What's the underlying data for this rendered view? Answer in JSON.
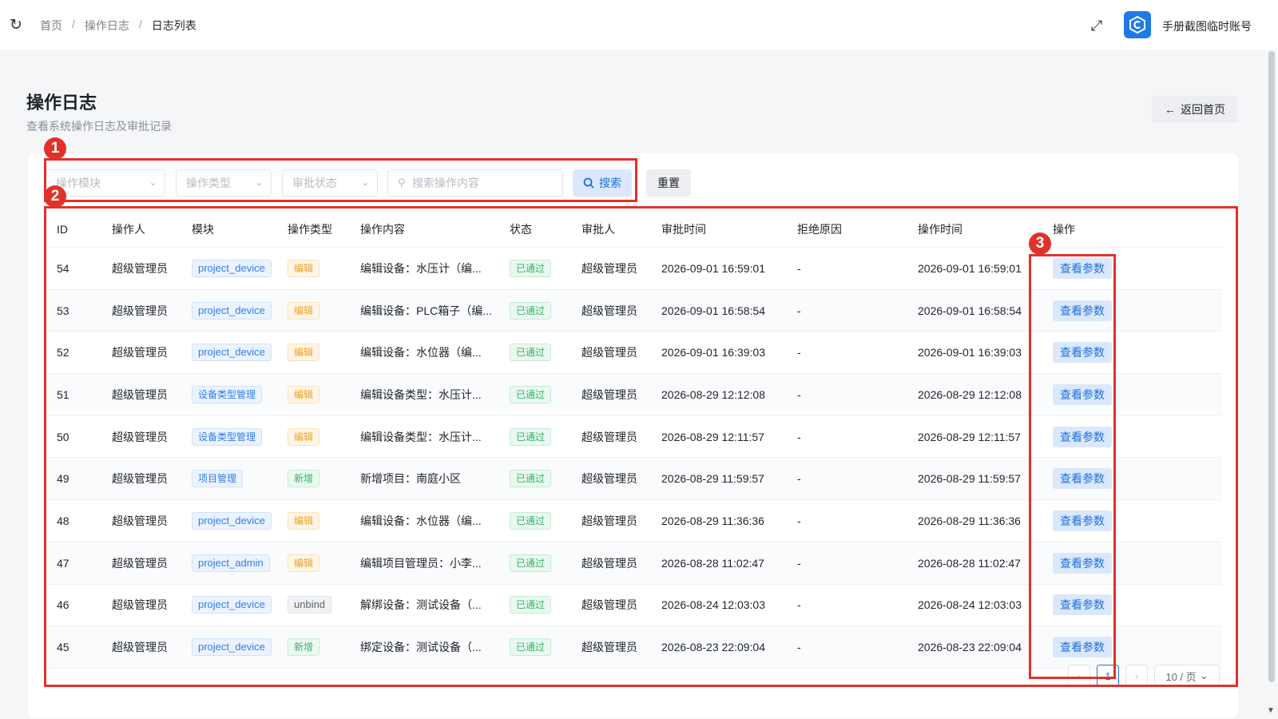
{
  "header": {
    "breadcrumb": [
      "首页",
      "操作日志",
      "日志列表"
    ],
    "breadcrumb_sep": "/",
    "username": "手册截图临时账号"
  },
  "page": {
    "title": "操作日志",
    "subtitle": "查看系统操作日志及审批记录",
    "back_label": "返回首页"
  },
  "filters": {
    "module_placeholder": "操作模块",
    "type_placeholder": "操作类型",
    "status_placeholder": "审批状态",
    "search_placeholder": "搜索操作内容",
    "search_label": "搜索",
    "reset_label": "重置"
  },
  "table": {
    "columns": [
      "ID",
      "操作人",
      "模块",
      "操作类型",
      "操作内容",
      "状态",
      "审批人",
      "审批时间",
      "拒绝原因",
      "操作时间",
      "操作"
    ],
    "rows": [
      {
        "id": "54",
        "operator": "超级管理员",
        "module": "project_device",
        "type": "编辑",
        "content": "编辑设备：水压计（编...",
        "status": "已通过",
        "approver": "超级管理员",
        "approve_time": "2026-09-01 16:59:01",
        "reason": "-",
        "op_time": "2026-09-01 16:59:01",
        "action": "查看参数"
      },
      {
        "id": "53",
        "operator": "超级管理员",
        "module": "project_device",
        "type": "编辑",
        "content": "编辑设备：PLC箱子（编...",
        "status": "已通过",
        "approver": "超级管理员",
        "approve_time": "2026-09-01 16:58:54",
        "reason": "-",
        "op_time": "2026-09-01 16:58:54",
        "action": "查看参数"
      },
      {
        "id": "52",
        "operator": "超级管理员",
        "module": "project_device",
        "type": "编辑",
        "content": "编辑设备：水位器（编...",
        "status": "已通过",
        "approver": "超级管理员",
        "approve_time": "2026-09-01 16:39:03",
        "reason": "-",
        "op_time": "2026-09-01 16:39:03",
        "action": "查看参数"
      },
      {
        "id": "51",
        "operator": "超级管理员",
        "module": "设备类型管理",
        "type": "编辑",
        "content": "编辑设备类型：水压计...",
        "status": "已通过",
        "approver": "超级管理员",
        "approve_time": "2026-08-29 12:12:08",
        "reason": "-",
        "op_time": "2026-08-29 12:12:08",
        "action": "查看参数"
      },
      {
        "id": "50",
        "operator": "超级管理员",
        "module": "设备类型管理",
        "type": "编辑",
        "content": "编辑设备类型：水压计...",
        "status": "已通过",
        "approver": "超级管理员",
        "approve_time": "2026-08-29 12:11:57",
        "reason": "-",
        "op_time": "2026-08-29 12:11:57",
        "action": "查看参数"
      },
      {
        "id": "49",
        "operator": "超级管理员",
        "module": "项目管理",
        "type": "新增",
        "content": "新增项目：南庭小区",
        "status": "已通过",
        "approver": "超级管理员",
        "approve_time": "2026-08-29 11:59:57",
        "reason": "-",
        "op_time": "2026-08-29 11:59:57",
        "action": "查看参数"
      },
      {
        "id": "48",
        "operator": "超级管理员",
        "module": "project_device",
        "type": "编辑",
        "content": "编辑设备：水位器（编...",
        "status": "已通过",
        "approver": "超级管理员",
        "approve_time": "2026-08-29 11:36:36",
        "reason": "-",
        "op_time": "2026-08-29 11:36:36",
        "action": "查看参数"
      },
      {
        "id": "47",
        "operator": "超级管理员",
        "module": "project_admin",
        "type": "编辑",
        "content": "编辑项目管理员：小李...",
        "status": "已通过",
        "approver": "超级管理员",
        "approve_time": "2026-08-28 11:02:47",
        "reason": "-",
        "op_time": "2026-08-28 11:02:47",
        "action": "查看参数"
      },
      {
        "id": "46",
        "operator": "超级管理员",
        "module": "project_device",
        "type": "unbind",
        "content": "解绑设备：测试设备（...",
        "status": "已通过",
        "approver": "超级管理员",
        "approve_time": "2026-08-24 12:03:03",
        "reason": "-",
        "op_time": "2026-08-24 12:03:03",
        "action": "查看参数"
      },
      {
        "id": "45",
        "operator": "超级管理员",
        "module": "project_device",
        "type": "新增",
        "content": "绑定设备：测试设备（...",
        "status": "已通过",
        "approver": "超级管理员",
        "approve_time": "2026-08-23 22:09:04",
        "reason": "-",
        "op_time": "2026-08-23 22:09:04",
        "action": "查看参数"
      }
    ]
  },
  "pagination": {
    "current": "1",
    "page_size": "10 / 页"
  },
  "annotations": [
    "1",
    "2",
    "3"
  ],
  "colors": {
    "accent": "#1f6fe0",
    "annotation": "#e2312b",
    "tag_edit": "#f0a02a",
    "tag_add": "#38b26a",
    "tag_module": "#2f7cf0"
  }
}
